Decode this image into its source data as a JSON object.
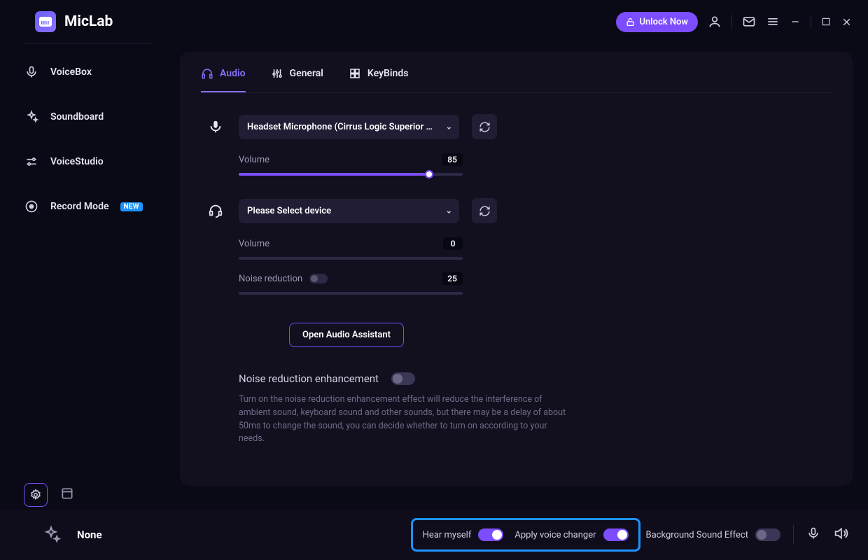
{
  "header": {
    "app_name": "MicLab",
    "unlock_label": "Unlock Now"
  },
  "sidebar": {
    "items": [
      {
        "label": "VoiceBox",
        "icon": "mic"
      },
      {
        "label": "Soundboard",
        "icon": "sparkle"
      },
      {
        "label": "VoiceStudio",
        "icon": "sliders"
      },
      {
        "label": "Record Mode",
        "icon": "record",
        "badge": "NEW"
      }
    ]
  },
  "tabs": [
    {
      "label": "Audio",
      "active": true,
      "icon": "headphones"
    },
    {
      "label": "General",
      "active": false,
      "icon": "sliders"
    },
    {
      "label": "KeyBinds",
      "active": false,
      "icon": "grid"
    }
  ],
  "audio": {
    "mic": {
      "device": "Headset Microphone (Cirrus Logic Superior High De",
      "volume_label": "Volume",
      "volume": 85
    },
    "output": {
      "device": "Please Select device",
      "volume_label": "Volume",
      "volume": 0,
      "noise_label": "Noise reduction",
      "noise_value": 25,
      "noise_on": false
    },
    "assistant_label": "Open Audio Assistant",
    "nre": {
      "title": "Noise reduction enhancement",
      "on": false,
      "desc": "Turn on the noise reduction enhancement effect will reduce the interference of ambient sound, keyboard sound and other sounds, but there may be a delay of about 50ms to change the sound, you can decide whether to turn on according to your needs."
    }
  },
  "bottom": {
    "status": "None",
    "hear_label": "Hear myself",
    "hear_on": true,
    "apply_label": "Apply voice changer",
    "apply_on": true,
    "bg_label": "Background Sound Effect",
    "bg_on": false
  }
}
